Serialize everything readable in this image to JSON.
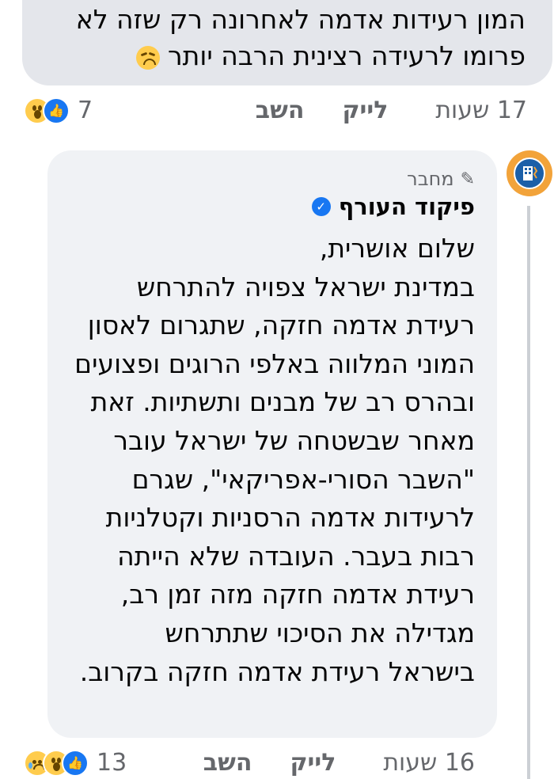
{
  "previous_comment": {
    "lines": [
      "המון רעידות אדמה לאחרונה  רק שזה לא",
      "פרומו לרעידה רצינית הרבה יותר"
    ],
    "emoji": "weary-face-emoji"
  },
  "previous_actions": {
    "time": "17 שעות",
    "like": "לייק",
    "reply": "השב",
    "reaction_count": "7",
    "reactions": [
      "wow",
      "like"
    ]
  },
  "comment": {
    "author_badge": "מחבר",
    "author_name": "פיקוד העורף",
    "verified": true,
    "lines": [
      "שלום אושרית,",
      "במדינת ישראל צפויה להתרחש",
      "רעידת אדמה חזקה, שתגרום לאסון",
      "המוני המלווה באלפי הרוגים ופצועים",
      "ובהרס רב של מבנים ותשתיות. זאת",
      "מאחר שבשטחה של ישראל עובר",
      "\"השבר הסורי-אפריקאי\", שגרם",
      "לרעידות אדמה הרסניות וקטלניות",
      "רבות בעבר. העובדה שלא הייתה",
      "רעידת אדמה חזקה מזה זמן רב,",
      "מגדילה את הסיכוי שתתרחש",
      "בישראל רעידת אדמה חזקה בקרוב."
    ]
  },
  "comment_actions": {
    "time": "16 שעות",
    "like": "לייק",
    "reply": "השב",
    "reaction_count": "13",
    "reactions": [
      "sad",
      "wow",
      "like"
    ]
  },
  "colors": {
    "bubble": "#f0f2f5",
    "bubble_top": "#e4e6eb",
    "meta_text": "#65676b",
    "like_blue": "#1877f2",
    "avatar_orange": "#f2a33a",
    "avatar_blue": "#1b5fa8"
  }
}
